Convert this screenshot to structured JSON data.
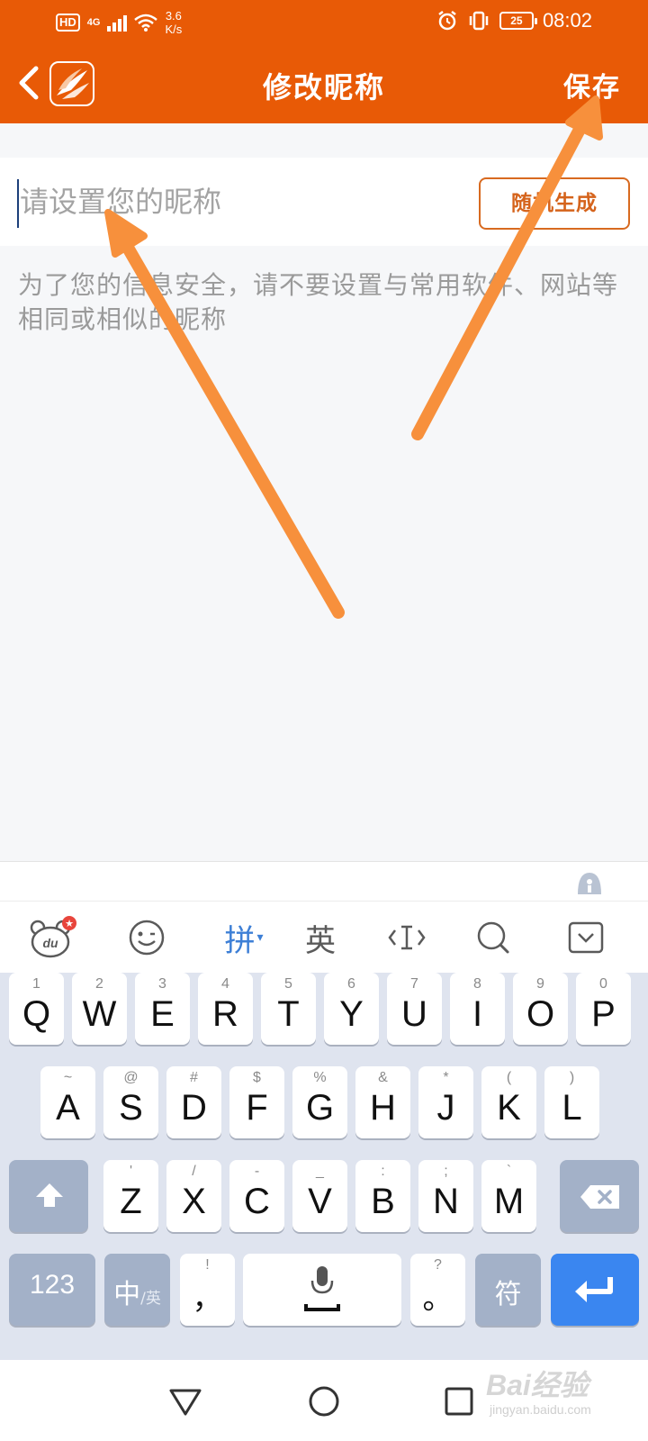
{
  "status_bar": {
    "hd": "HD",
    "network": "4G",
    "speed_value": "3.6",
    "speed_unit": "K/s",
    "battery": "25",
    "time": "08:02"
  },
  "header": {
    "title": "修改昵称",
    "save_label": "保存",
    "back_icon": "chevron-left-icon",
    "logo_icon": "app-logo"
  },
  "form": {
    "nickname_value": "",
    "nickname_placeholder": "请设置您的昵称",
    "random_button": "随机生成",
    "hint": "为了您的信息安全，请不要设置与常用软件、网站等相同或相似的昵称"
  },
  "keyboard": {
    "toolbar": {
      "du_label": "du",
      "pinyin": "拼",
      "english": "英"
    },
    "row1": [
      {
        "sym": "1",
        "key": "Q"
      },
      {
        "sym": "2",
        "key": "W"
      },
      {
        "sym": "3",
        "key": "E"
      },
      {
        "sym": "4",
        "key": "R"
      },
      {
        "sym": "5",
        "key": "T"
      },
      {
        "sym": "6",
        "key": "Y"
      },
      {
        "sym": "7",
        "key": "U"
      },
      {
        "sym": "8",
        "key": "I"
      },
      {
        "sym": "9",
        "key": "O"
      },
      {
        "sym": "0",
        "key": "P"
      }
    ],
    "row2": [
      {
        "sym": "~",
        "key": "A"
      },
      {
        "sym": "@",
        "key": "S"
      },
      {
        "sym": "#",
        "key": "D"
      },
      {
        "sym": "$",
        "key": "F"
      },
      {
        "sym": "%",
        "key": "G"
      },
      {
        "sym": "&",
        "key": "H"
      },
      {
        "sym": "*",
        "key": "J"
      },
      {
        "sym": "(",
        "key": "K"
      },
      {
        "sym": ")",
        "key": "L"
      }
    ],
    "row3": [
      {
        "sym": "'",
        "key": "Z"
      },
      {
        "sym": "/",
        "key": "X"
      },
      {
        "sym": "-",
        "key": "C"
      },
      {
        "sym": "_",
        "key": "V"
      },
      {
        "sym": ":",
        "key": "B"
      },
      {
        "sym": ";",
        "key": "N"
      },
      {
        "sym": "`",
        "key": "M"
      }
    ],
    "bottom": {
      "num": "123",
      "zh": "中",
      "zh_alt": "英",
      "comma_sym": "!",
      "comma": "，",
      "period_sym": "?",
      "period": "。",
      "symbols": "符"
    }
  },
  "watermark": {
    "brand": "Bai",
    "brand_cn": "经验",
    "site": "jingyan.baidu.com"
  },
  "colors": {
    "header": "#e85a06",
    "accent": "#d5631b",
    "enter": "#3a86f0",
    "annotation_arrow": "#f7903c"
  }
}
